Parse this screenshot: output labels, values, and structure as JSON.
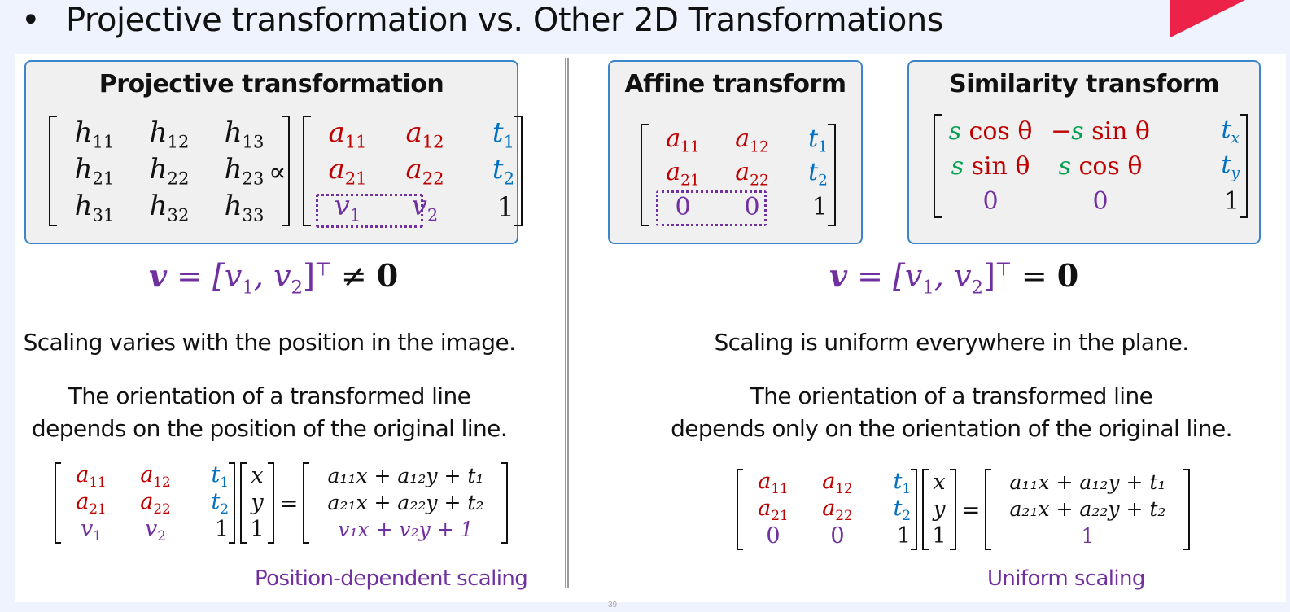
{
  "slide": {
    "title_bullet": "•",
    "title": "Projective transformation vs. Other 2D Transformations",
    "page_number": "39",
    "accent_color": "#ec2249"
  },
  "projective": {
    "box_title": "Projective transformation",
    "h_matrix": [
      [
        "h",
        "11"
      ],
      [
        "h",
        "12"
      ],
      [
        "h",
        "13"
      ],
      [
        "h",
        "21"
      ],
      [
        "h",
        "22"
      ],
      [
        "h",
        "23"
      ],
      [
        "h",
        "31"
      ],
      [
        "h",
        "32"
      ],
      [
        "h",
        "33"
      ]
    ],
    "proportional_symbol": "∝",
    "a_matrix": [
      [
        "a",
        "11"
      ],
      [
        "a",
        "12"
      ],
      [
        "t",
        "1"
      ],
      [
        "a",
        "21"
      ],
      [
        "a",
        "22"
      ],
      [
        "t",
        "2"
      ],
      [
        "v",
        "1"
      ],
      [
        "v",
        "2"
      ],
      [
        "1",
        ""
      ]
    ],
    "vector_equation": {
      "lhs": "v",
      "mid": " = [v",
      "sub1": "1",
      "comma": ", v",
      "sub2": "2",
      "close": "]",
      "sup": "⊤",
      "rel": " ≠ ",
      "rhs": "0"
    },
    "statement_1": "Scaling varies with the position in the image.",
    "statement_2_line1": "The orientation of a transformed line",
    "statement_2_line2": "depends on the position of the original line.",
    "equation": {
      "m": [
        [
          "a",
          "11"
        ],
        [
          "a",
          "12"
        ],
        [
          "t",
          "1"
        ],
        [
          "a",
          "21"
        ],
        [
          "a",
          "22"
        ],
        [
          "t",
          "2"
        ],
        [
          "v",
          "1"
        ],
        [
          "v",
          "2"
        ],
        [
          "1",
          ""
        ]
      ],
      "vec": [
        "x",
        "y",
        "1"
      ],
      "equals": "=",
      "result": [
        "a₁₁x + a₁₂y + t₁",
        "a₂₁x + a₂₂y + t₂",
        "v₁x + v₂y + 1"
      ]
    },
    "caption": "Position-dependent scaling"
  },
  "affine": {
    "box_title": "Affine transform",
    "matrix": [
      [
        "a",
        "11"
      ],
      [
        "a",
        "12"
      ],
      [
        "t",
        "1"
      ],
      [
        "a",
        "21"
      ],
      [
        "a",
        "22"
      ],
      [
        "t",
        "2"
      ],
      [
        "0",
        ""
      ],
      [
        "0",
        ""
      ],
      [
        "1",
        ""
      ]
    ]
  },
  "similarity": {
    "box_title": "Similarity transform",
    "row1": {
      "c1_s": "s",
      "c1_f": " cos θ",
      "c2_minus": "−",
      "c2_s": "s",
      "c2_f": " sin θ",
      "c3_t": "t",
      "c3_sub": "x"
    },
    "row2": {
      "c1_s": "s",
      "c1_f": " sin θ",
      "c2_s": "s",
      "c2_f": " cos θ",
      "c3_t": "t",
      "c3_sub": "y"
    },
    "row3": [
      "0",
      "0",
      "1"
    ]
  },
  "right_side": {
    "vector_equation": {
      "lhs": "v",
      "mid": " = [v",
      "sub1": "1",
      "comma": ", v",
      "sub2": "2",
      "close": "]",
      "sup": "⊤",
      "rel": " = ",
      "rhs": "0"
    },
    "statement_1": "Scaling is uniform everywhere in the plane.",
    "statement_2_line1": "The orientation of a transformed line",
    "statement_2_line2": "depends only on the orientation of the original line.",
    "equation": {
      "m": [
        [
          "a",
          "11"
        ],
        [
          "a",
          "12"
        ],
        [
          "t",
          "1"
        ],
        [
          "a",
          "21"
        ],
        [
          "a",
          "22"
        ],
        [
          "t",
          "2"
        ],
        [
          "0",
          ""
        ],
        [
          "0",
          ""
        ],
        [
          "1",
          ""
        ]
      ],
      "vec": [
        "x",
        "y",
        "1"
      ],
      "equals": "=",
      "result": [
        "a₁₁x + a₁₂y + t₁",
        "a₂₁x + a₂₂y + t₂",
        "1"
      ]
    },
    "caption": "Uniform scaling"
  },
  "colors": {
    "a": "#c00000",
    "t": "#0070c0",
    "v": "#7030a0",
    "s": "#00a050",
    "box_border": "#3a86c8",
    "box_fill": "#f0f0f0"
  }
}
